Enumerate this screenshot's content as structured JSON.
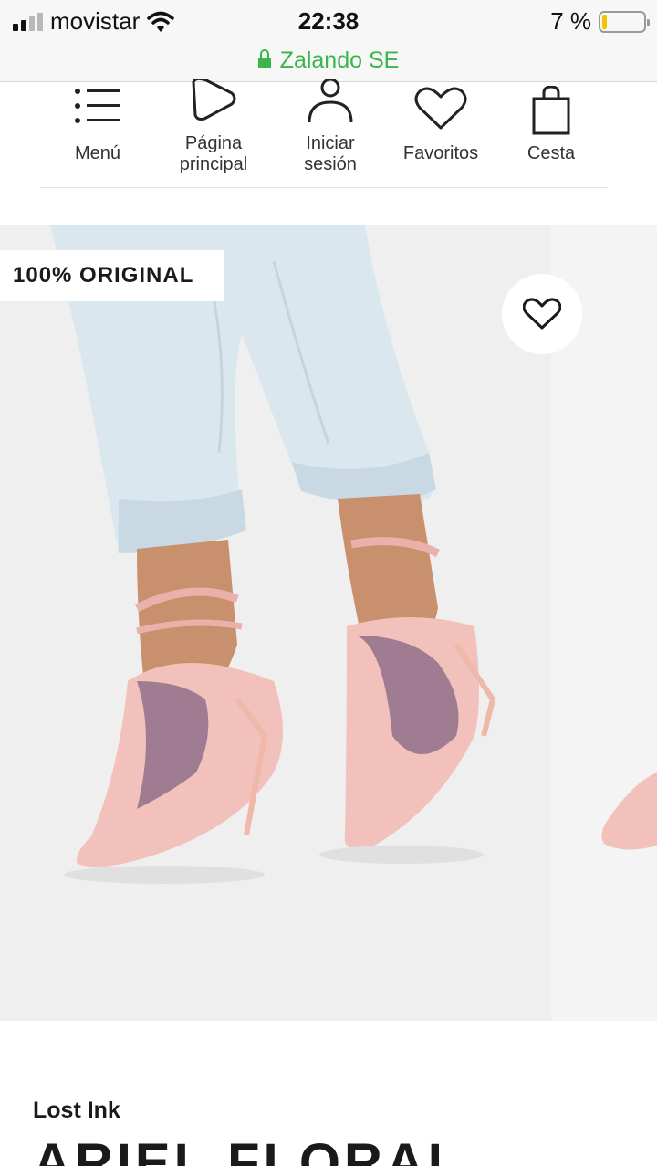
{
  "status_bar": {
    "carrier": "movistar",
    "time": "22:38",
    "battery": "7 %",
    "battery_level": 0.07,
    "signal_bars": 4,
    "signal_active": 2
  },
  "url_bar": {
    "site": "Zalando SE",
    "secure_color": "#3bb54a"
  },
  "nav": {
    "items": [
      {
        "label": "Menú",
        "icon": "menu-icon"
      },
      {
        "label": "Página principal",
        "icon": "home-icon"
      },
      {
        "label": "Iniciar sesión",
        "icon": "user-icon"
      },
      {
        "label": "Favoritos",
        "icon": "heart-icon"
      },
      {
        "label": "Cesta",
        "icon": "bag-icon"
      }
    ]
  },
  "product": {
    "badge": "100% ORIGINAL",
    "brand": "Lost Ink",
    "title": "ARIEL FLORAL",
    "wishlist_icon": "heart-icon"
  }
}
